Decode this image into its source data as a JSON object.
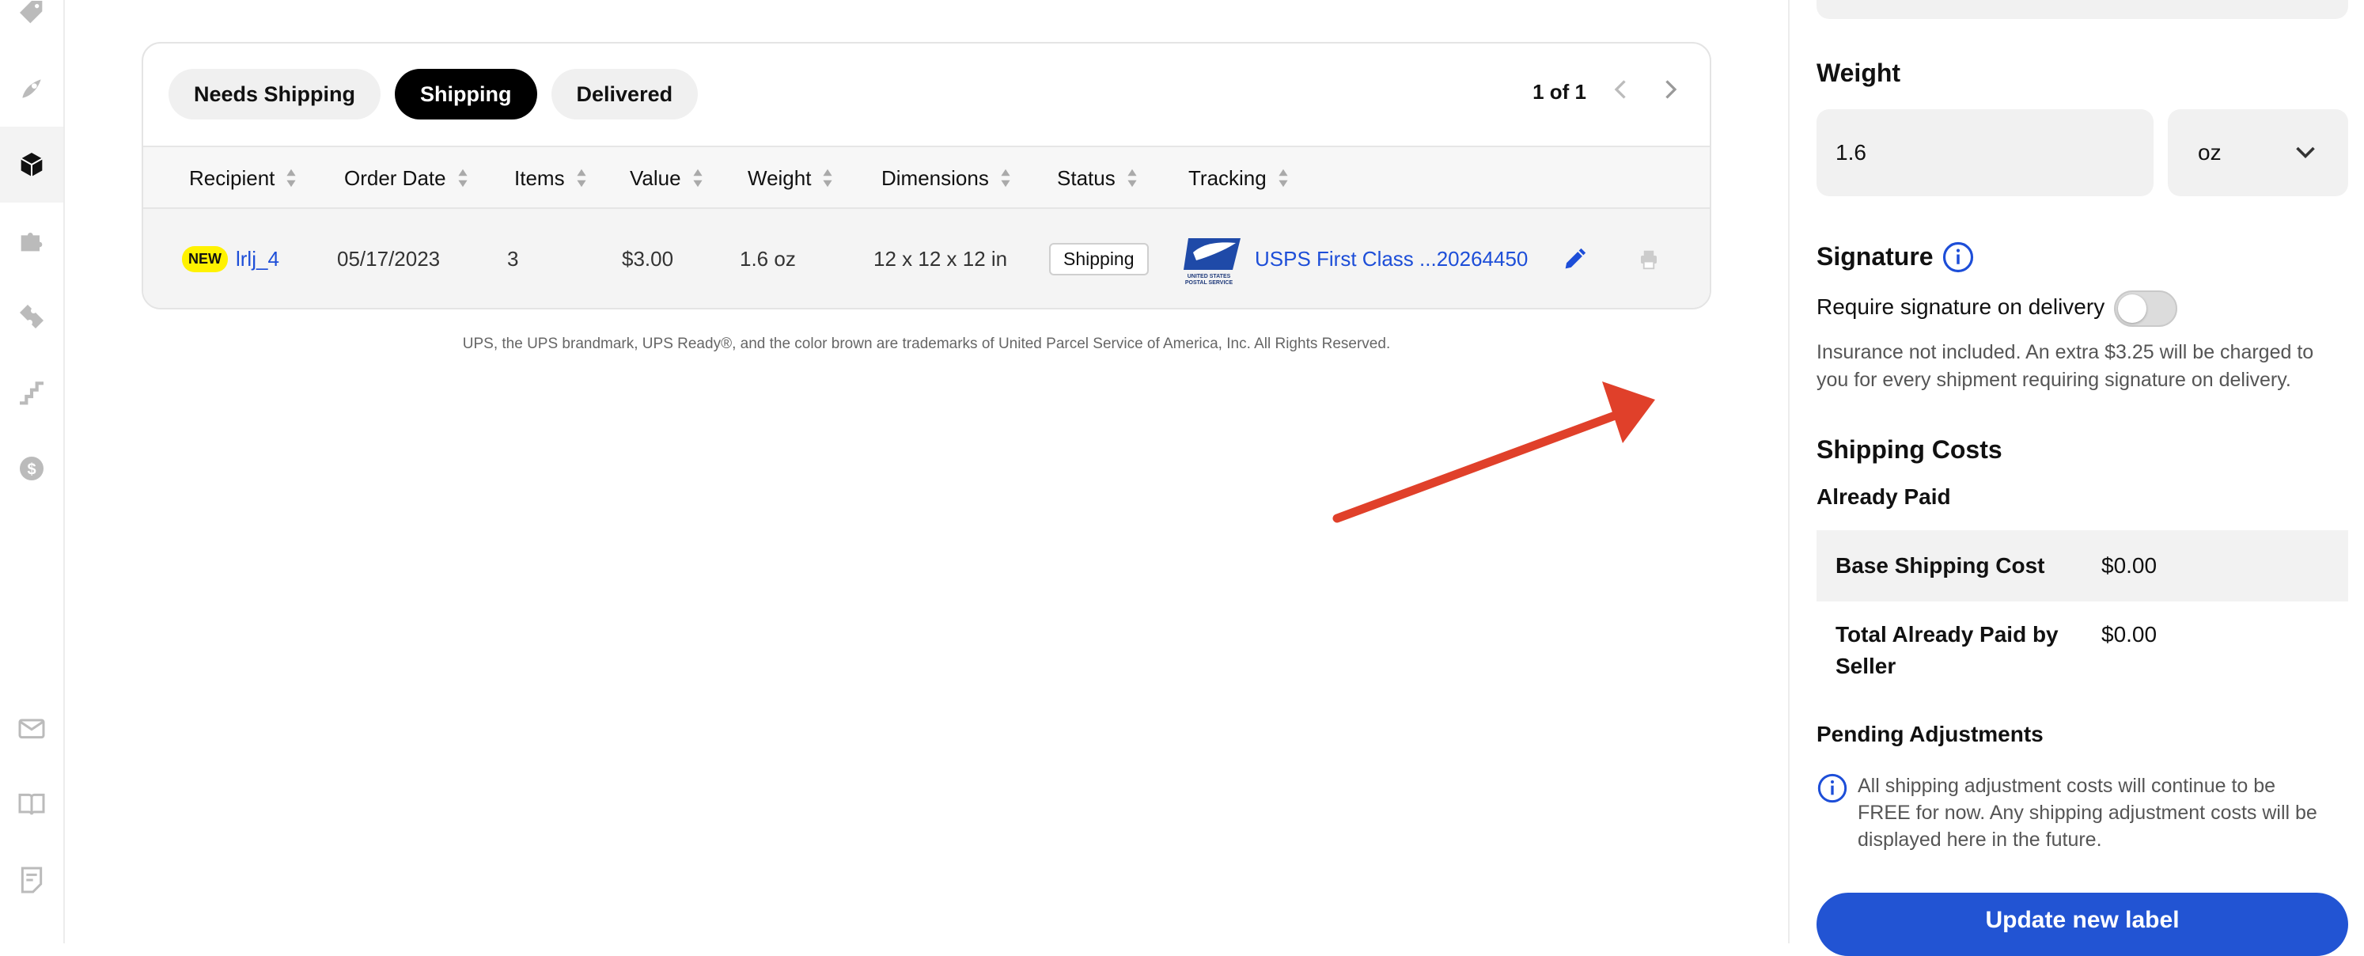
{
  "colors": {
    "accent": "#1d4ed8",
    "button_primary": "#2254d3",
    "annotation": "#e0402a",
    "badge_new": "#fff200"
  },
  "sidebar": {
    "icons": [
      "tag-icon",
      "rocket-icon",
      "box-icon",
      "puzzle-icon",
      "ticket-icon",
      "stairs-icon",
      "dollar-icon",
      "mail-icon",
      "book-icon",
      "notes-icon"
    ],
    "active_item": "box-icon"
  },
  "tabs": [
    {
      "label": "Needs Shipping",
      "active": false
    },
    {
      "label": "Shipping",
      "active": true
    },
    {
      "label": "Delivered",
      "active": false
    }
  ],
  "pager": {
    "text": "1 of 1"
  },
  "table": {
    "columns": [
      "Recipient",
      "Order Date",
      "Items",
      "Value",
      "Weight",
      "Dimensions",
      "Status",
      "Tracking"
    ],
    "rows": [
      {
        "badge": "NEW",
        "recipient": "lrlj_4",
        "order_date": "05/17/2023",
        "items": "3",
        "value": "$3.00",
        "weight": "1.6 oz",
        "dimensions": "12 x 12 x 12 in",
        "status": "Shipping",
        "carrier_logo_text": "UNITED STATES POSTAL SERVICE",
        "tracking": "USPS First Class ...20264450"
      }
    ]
  },
  "disclaimer": "UPS, the UPS brandmark, UPS Ready®, and the color brown are trademarks of United Parcel Service of America, Inc. All Rights Reserved.",
  "panel": {
    "weight": {
      "title": "Weight",
      "value": "1.6",
      "unit": "oz"
    },
    "signature": {
      "title": "Signature",
      "toggle_label": "Require signature on delivery",
      "toggle_on": false,
      "note": "Insurance not included. An extra $3.25 will be charged to you for every shipment requiring signature on delivery."
    },
    "shipping_costs": {
      "title": "Shipping Costs",
      "already_paid_title": "Already Paid",
      "rows": [
        {
          "label": "Base Shipping Cost",
          "value": "$0.00"
        },
        {
          "label": "Total Already Paid by Seller",
          "value": "$0.00"
        }
      ]
    },
    "pending": {
      "title": "Pending Adjustments",
      "note": "All shipping adjustment costs will continue to be FREE for now. Any shipping adjustment costs will be displayed here in the future."
    },
    "update_button": "Update new label"
  }
}
